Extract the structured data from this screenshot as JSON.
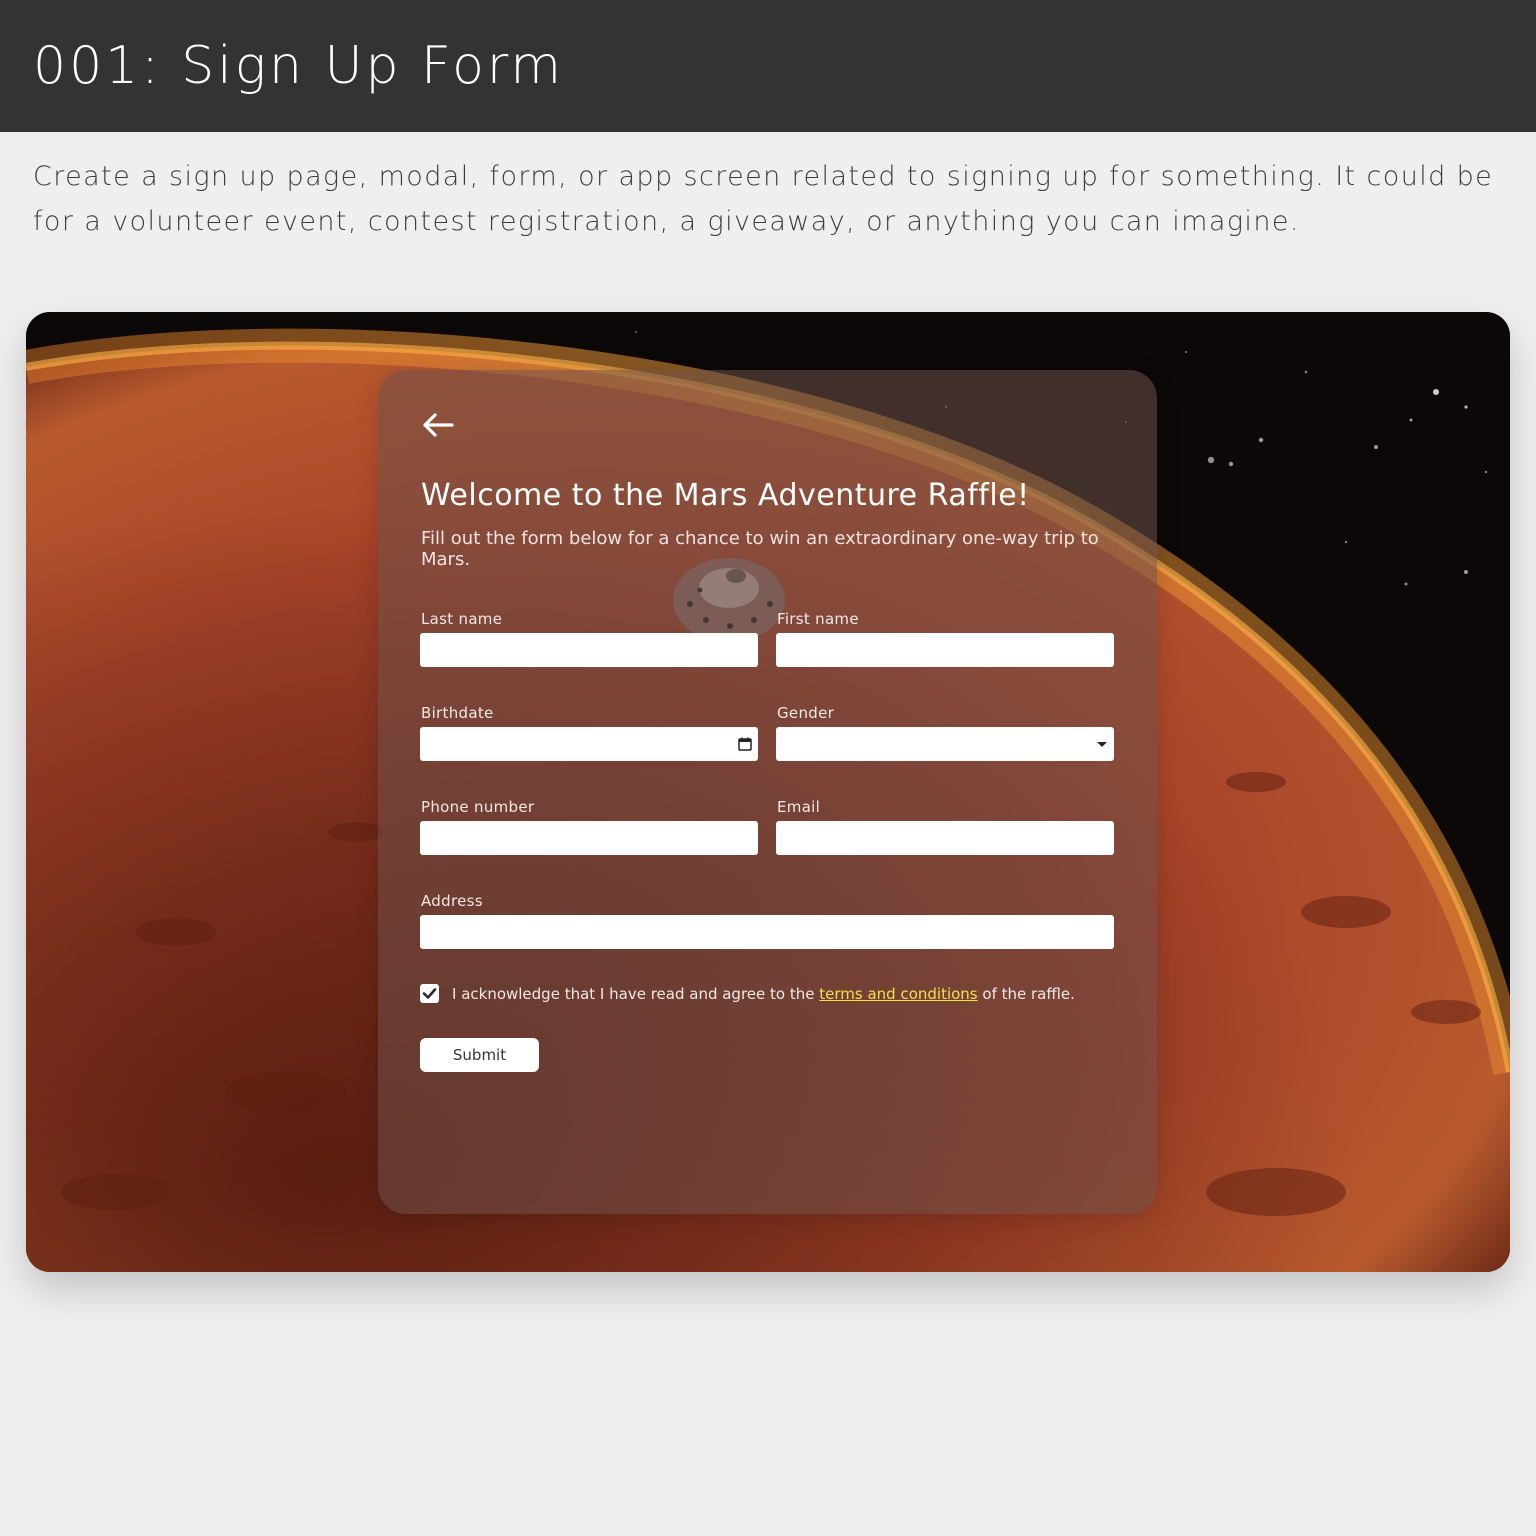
{
  "header": {
    "title": "001: Sign Up Form"
  },
  "prompt": {
    "text": "Create a sign up page, modal, form, or app screen related to signing up for something. It could be for a volunteer event, contest registration, a giveaway, or anything you can imagine."
  },
  "colors": {
    "header_bg": "#333333",
    "page_bg": "#efefef",
    "link": "#f1e04a",
    "mars": "#a8442a"
  },
  "form": {
    "back_icon": "arrow-left-icon",
    "title": "Welcome to the Mars Adventure Raffle!",
    "subtitle": "Fill out the form below for a chance to win an extraordinary one-way trip to Mars.",
    "fields": {
      "last_name": {
        "label": "Last name",
        "value": ""
      },
      "first_name": {
        "label": "First name",
        "value": ""
      },
      "birthdate": {
        "label": "Birthdate",
        "value": "",
        "icon": "calendar-icon"
      },
      "gender": {
        "label": "Gender",
        "value": "",
        "icon": "caret-down-icon"
      },
      "phone": {
        "label": "Phone number",
        "value": ""
      },
      "email": {
        "label": "Email",
        "value": ""
      },
      "address": {
        "label": "Address",
        "value": ""
      }
    },
    "agreement": {
      "checked": true,
      "prefix": "I acknowledge that I have read and agree to the",
      "link": "terms and conditions",
      "suffix": "of the raffle."
    },
    "submit_label": "Submit"
  }
}
